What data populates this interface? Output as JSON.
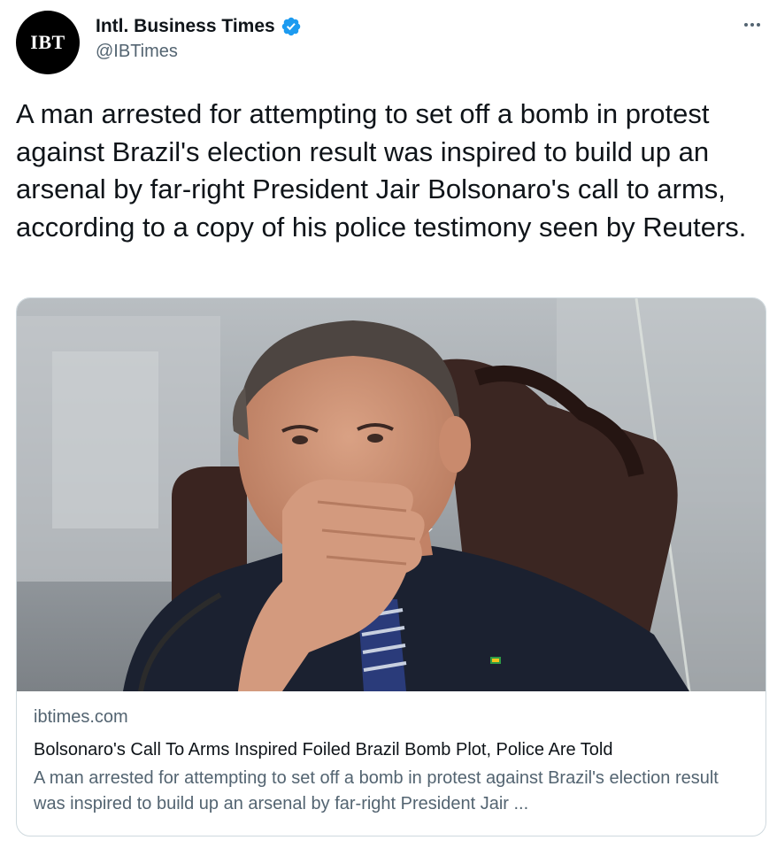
{
  "author": {
    "avatar_text": "IBT",
    "display_name": "Intl. Business Times",
    "handle": "@IBTimes",
    "verified_color": "#1d9bf0"
  },
  "tweet": {
    "text": "A man arrested for attempting to set off a bomb in protest against Brazil's election result was inspired to build up an arsenal by far-right President Jair Bolsonaro's call to arms, according to a copy of his police testimony seen by Reuters."
  },
  "link_card": {
    "domain": "ibtimes.com",
    "title": "Bolsonaro's Call To Arms Inspired Foiled Brazil Bomb Plot, Police Are Told",
    "description": "A man arrested for attempting to set off a bomb in protest against Brazil's election result was inspired to build up an arsenal by far-right President Jair ..."
  },
  "icons": {
    "more": "more-horizontal-icon",
    "verified": "verified-badge-icon"
  }
}
